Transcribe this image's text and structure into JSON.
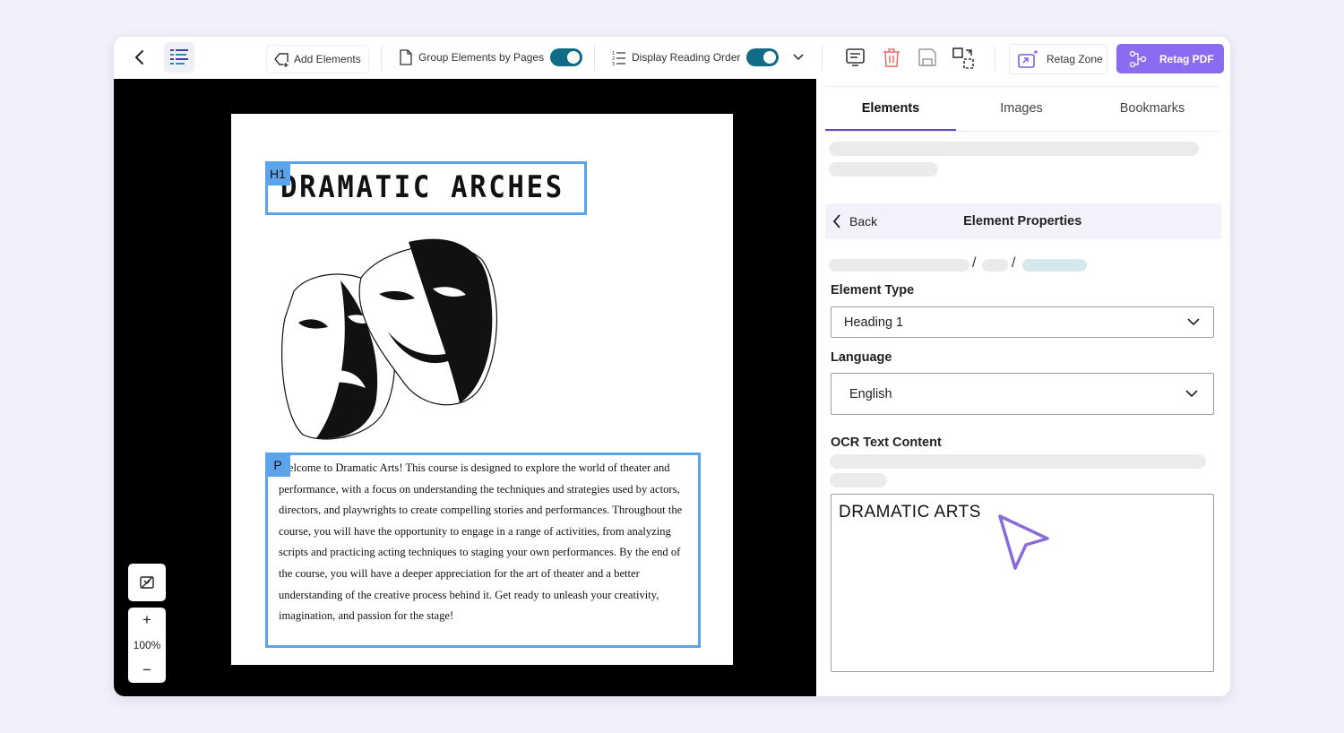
{
  "toolbar": {
    "add_elements": "Add Elements",
    "group_by_pages": "Group Elements by Pages",
    "display_reading_order": "Display Reading Order",
    "retag_zone": "Retag Zone",
    "retag_pdf": "Retag PDF"
  },
  "document": {
    "h1_tag": "H1",
    "h1_text": "DRAMATIC ARCHES",
    "p_tag": "P",
    "p_text": "Welcome to Dramatic Arts! This course is designed to explore the world of theater and performance, with a focus on understanding the techniques and strategies used by actors, directors, and playwrights to create compelling stories and performances. Throughout the course, you will have the opportunity to engage in a range of activities, from analyzing scripts and practicing acting techniques to staging your own performances. By the end of the course, you will have a deeper appreciation for the art of theater and a better understanding of the creative process behind it. Get ready to unleash your creativity, imagination, and passion for the stage!"
  },
  "zoom": {
    "level": "100%",
    "plus": "+",
    "minus": "−"
  },
  "panel": {
    "tabs": [
      "Elements",
      "Images",
      "Bookmarks"
    ],
    "back": "Back",
    "header_title": "Element Properties",
    "element_type_label": "Element Type",
    "element_type_value": "Heading 1",
    "language_label": "Language",
    "language_value": "English",
    "ocr_label": "OCR Text Content",
    "ocr_value": "DRAMATIC ARTS"
  },
  "colors": {
    "accent": "#8b6cf0",
    "toggle": "#0f6b86",
    "tag_blue": "#5ba4ec",
    "tab_underline": "#6a49c9"
  },
  "icons": [
    "back-arrow-icon",
    "list-icon",
    "add-element-icon",
    "page-icon",
    "reading-order-icon",
    "chevron-down-icon",
    "comment-icon",
    "trash-icon",
    "save-icon",
    "swap-icon",
    "retag-zone-icon",
    "retag-pdf-icon",
    "fit-page-icon",
    "cursor-arrow-icon"
  ]
}
